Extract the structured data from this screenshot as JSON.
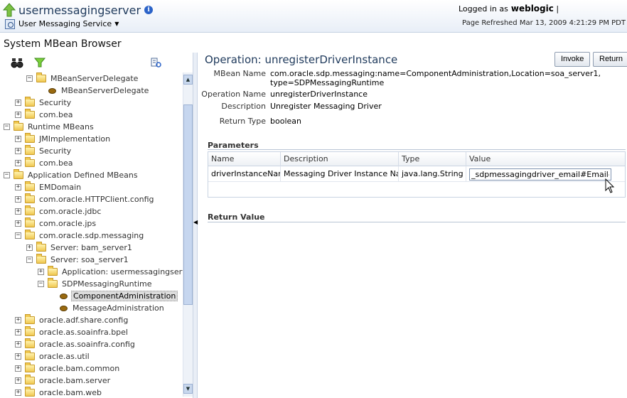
{
  "header": {
    "app_title": "usermessagingserver",
    "service_menu": "User Messaging Service",
    "logged_in_label": "Logged in as",
    "user": "weblogic",
    "refreshed": "Page Refreshed Mar 13, 2009 4:21:29 PM PDT"
  },
  "left": {
    "title": "System MBean Browser",
    "tree": [
      {
        "label": "MBeanServerDelegate",
        "expander": "−",
        "icon": "folder"
      },
      {
        "label": "MBeanServerDelegate",
        "expander": "",
        "icon": "bean"
      },
      {
        "label": "Security",
        "expander": "+",
        "icon": "folder"
      },
      {
        "label": "com.bea",
        "expander": "+",
        "icon": "folder"
      },
      {
        "label": "Runtime MBeans",
        "expander": "−",
        "icon": "folder"
      },
      {
        "label": "JMImplementation",
        "expander": "+",
        "icon": "folder"
      },
      {
        "label": "Security",
        "expander": "+",
        "icon": "folder"
      },
      {
        "label": "com.bea",
        "expander": "+",
        "icon": "folder"
      },
      {
        "label": "Application Defined MBeans",
        "expander": "−",
        "icon": "folder"
      },
      {
        "label": "EMDomain",
        "expander": "+",
        "icon": "folder"
      },
      {
        "label": "com.oracle.HTTPClient.config",
        "expander": "+",
        "icon": "folder"
      },
      {
        "label": "com.oracle.jdbc",
        "expander": "+",
        "icon": "folder"
      },
      {
        "label": "com.oracle.jps",
        "expander": "+",
        "icon": "folder"
      },
      {
        "label": "com.oracle.sdp.messaging",
        "expander": "−",
        "icon": "folder"
      },
      {
        "label": "Server: bam_server1",
        "expander": "+",
        "icon": "folder"
      },
      {
        "label": "Server: soa_server1",
        "expander": "−",
        "icon": "folder"
      },
      {
        "label": "Application: usermessagingserver",
        "expander": "+",
        "icon": "folder"
      },
      {
        "label": "SDPMessagingRuntime",
        "expander": "−",
        "icon": "folder"
      },
      {
        "label": "ComponentAdministration",
        "expander": "",
        "icon": "bean"
      },
      {
        "label": "MessageAdministration",
        "expander": "",
        "icon": "bean"
      },
      {
        "label": "oracle.adf.share.config",
        "expander": "+",
        "icon": "folder"
      },
      {
        "label": "oracle.as.soainfra.bpel",
        "expander": "+",
        "icon": "folder"
      },
      {
        "label": "oracle.as.soainfra.config",
        "expander": "+",
        "icon": "folder"
      },
      {
        "label": "oracle.as.util",
        "expander": "+",
        "icon": "folder"
      },
      {
        "label": "oracle.bam.common",
        "expander": "+",
        "icon": "folder"
      },
      {
        "label": "oracle.bam.server",
        "expander": "+",
        "icon": "folder"
      },
      {
        "label": "oracle.bam.web",
        "expander": "+",
        "icon": "folder"
      }
    ]
  },
  "main": {
    "title": "Operation: unregisterDriverInstance",
    "invoke_label": "Invoke",
    "return_label": "Return",
    "info": {
      "mbean_name_key": "MBean Name",
      "mbean_name_line1": "com.oracle.sdp.messaging:name=ComponentAdministration,Location=soa_server1,",
      "mbean_name_line2": "type=SDPMessagingRuntime",
      "operation_name_key": "Operation Name",
      "operation_name": "unregisterDriverInstance",
      "description_key": "Description",
      "description": "Unregister Messaging Driver",
      "return_type_key": "Return Type",
      "return_type": "boolean"
    },
    "parameters_heading": "Parameters",
    "columns": [
      "Name",
      "Description",
      "Type",
      "Value"
    ],
    "row": {
      "name": "driverInstanceName",
      "description": "Messaging Driver Instance Name",
      "type": "java.lang.String",
      "value": "_sdpmessagingdriver_email#Email-Driver"
    },
    "return_value_heading": "Return Value"
  },
  "colors": {
    "header_title": "#1f3a5c",
    "header_bg": "#e8eef7",
    "selected_row": "#dcdcdc"
  }
}
